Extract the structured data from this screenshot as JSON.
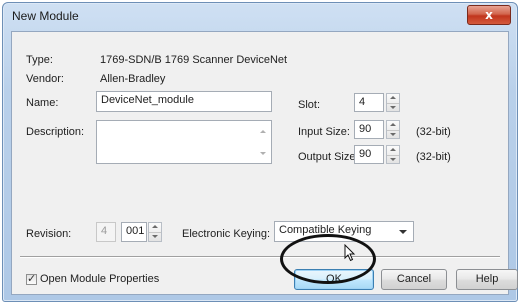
{
  "window": {
    "title": "New Module",
    "close_glyph": "x"
  },
  "fields": {
    "type_label": "Type:",
    "type_value": "1769-SDN/B 1769 Scanner DeviceNet",
    "vendor_label": "Vendor:",
    "vendor_value": "Allen-Bradley",
    "name_label": "Name:",
    "name_value": "DeviceNet_module",
    "description_label": "Description:",
    "description_value": "",
    "slot_label": "Slot:",
    "slot_value": "4",
    "input_size_label": "Input Size:",
    "input_size_value": "90",
    "input_size_unit": "(32-bit)",
    "output_size_label": "Output Size:",
    "output_size_value": "90",
    "output_size_unit": "(32-bit)",
    "revision_label": "Revision:",
    "revision_major": "4",
    "revision_minor": "001",
    "electronic_keying_label": "Electronic Keying:",
    "electronic_keying_value": "Compatible Keying"
  },
  "footer": {
    "open_module_properties_label": "Open Module Properties",
    "open_module_properties_checked": true,
    "ok_label": "OK",
    "cancel_label": "Cancel",
    "help_label": "Help"
  },
  "colors": {
    "title_bar": "#b9d0ea",
    "close_button": "#c1351d",
    "dialog_background": "#f0f0f0",
    "highlight_ellipse": "#111111"
  },
  "icons": [
    "close-icon",
    "spin-up-icon",
    "spin-down-icon",
    "dropdown-arrow-icon",
    "checkmark-icon",
    "mouse-cursor-icon"
  ]
}
